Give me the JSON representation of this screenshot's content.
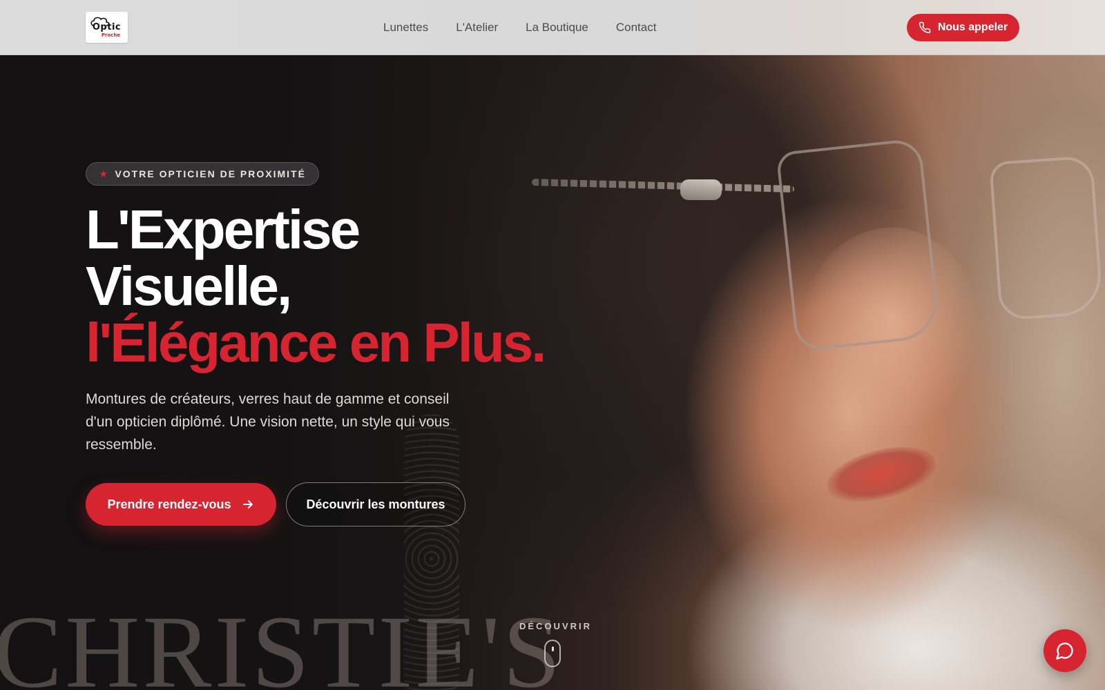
{
  "brand": {
    "logo_top": "Optic",
    "logo_bottom": "Proche"
  },
  "nav": {
    "items": [
      {
        "label": "Lunettes"
      },
      {
        "label": "L'Atelier"
      },
      {
        "label": "La Boutique"
      },
      {
        "label": "Contact"
      }
    ]
  },
  "header": {
    "call_label": "Nous appeler",
    "call_icon": "phone-icon"
  },
  "hero": {
    "badge_icon": "star-icon",
    "badge_text": "VOTRE OPTICIEN DE PROXIMITÉ",
    "headline_line1": "L'Expertise",
    "headline_line2": "Visuelle,",
    "headline_line3": "l'Élégance en Plus.",
    "lead": "Montures de créateurs, verres haut de gamme et conseil d'un opticien diplômé. Une vision nette, un style qui vous ressemble.",
    "primary_cta": "Prendre rendez-vous",
    "primary_cta_icon": "arrow-right-icon",
    "secondary_cta": "Découvrir les montures",
    "background_watermark": "CHRISTIE'S"
  },
  "scroll": {
    "label": "DÉCOUVRIR",
    "icon": "mouse-scroll-icon"
  },
  "chat": {
    "icon": "chat-bubble-icon"
  },
  "colors": {
    "accent": "#d62430",
    "header_bg": "#dcdcdc",
    "text_light": "#ffffff"
  }
}
